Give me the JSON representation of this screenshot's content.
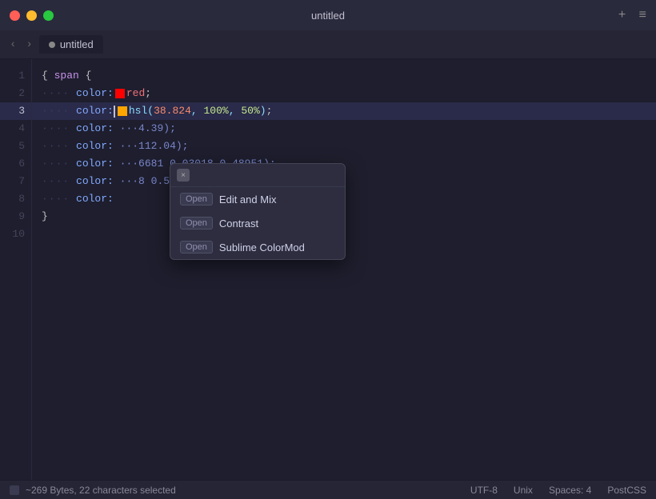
{
  "titlebar": {
    "title": "untitled",
    "add_label": "+",
    "menu_label": "≡"
  },
  "tab": {
    "name": "untitled",
    "dot_color": "#888"
  },
  "nav": {
    "back": "‹",
    "forward": "›"
  },
  "lines": [
    {
      "num": "1",
      "active": false,
      "content_type": "open_brace"
    },
    {
      "num": "2",
      "active": false,
      "content_type": "color_red"
    },
    {
      "num": "3",
      "active": true,
      "content_type": "color_hsl"
    },
    {
      "num": "4",
      "active": false,
      "content_type": "color_trunc1"
    },
    {
      "num": "5",
      "active": false,
      "content_type": "color_trunc2"
    },
    {
      "num": "6",
      "active": false,
      "content_type": "color_trunc3"
    },
    {
      "num": "7",
      "active": false,
      "content_type": "color_trunc4"
    },
    {
      "num": "8",
      "active": false,
      "content_type": "color_trunc5"
    },
    {
      "num": "9",
      "active": false,
      "content_type": "close_brace"
    },
    {
      "num": "10",
      "active": false,
      "content_type": "empty"
    }
  ],
  "popup": {
    "close_label": "×",
    "items": [
      {
        "badge": "Open",
        "label": "Edit and Mix"
      },
      {
        "badge": "Open",
        "label": "Contrast"
      },
      {
        "badge": "Open",
        "label": "Sublime ColorMod"
      }
    ]
  },
  "statusbar": {
    "size": "~269 Bytes, 22 characters selected",
    "encoding": "UTF-8",
    "line_ending": "Unix",
    "spaces": "Spaces: 4",
    "syntax": "PostCSS"
  }
}
